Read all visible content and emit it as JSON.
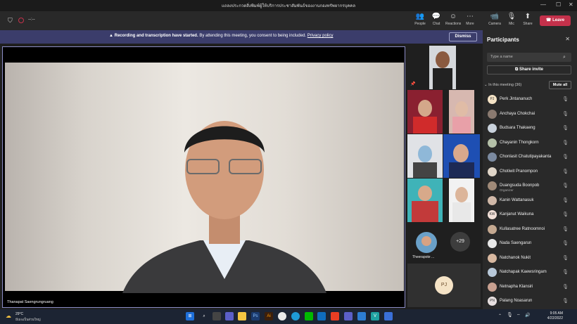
{
  "window": {
    "title": "แถลงประกวดสิ่งพิมพ์ผู้ให้บริการประชาสัมพันธ์ของงานกองทรัพยากรบุคคล",
    "minimize": "—",
    "maximize": "☐",
    "close": "✕"
  },
  "toolbar": {
    "timer": "--:--",
    "buttons": [
      {
        "label": "People",
        "icon": "people-icon",
        "glyph": "👥"
      },
      {
        "label": "Chat",
        "icon": "chat-icon",
        "glyph": "💬"
      },
      {
        "label": "Reactions",
        "icon": "reactions-icon",
        "glyph": "☺"
      },
      {
        "label": "More",
        "icon": "more-icon",
        "glyph": "⋯"
      },
      {
        "label": "Camera",
        "icon": "camera-icon",
        "glyph": "📹"
      },
      {
        "label": "Mic",
        "icon": "mic-icon",
        "glyph": "🎙"
      },
      {
        "label": "Share",
        "icon": "share-icon",
        "glyph": "⬆"
      }
    ],
    "leave_label": "Leave"
  },
  "banner": {
    "bold": "Recording and transcription have started.",
    "text": "By attending this meeting, you consent to being included.",
    "link": "Privacy policy",
    "dismiss": "Dismiss"
  },
  "stage": {
    "main_speaker": "Thanapat Saengrungruang",
    "overflow_count": "+29",
    "tile_name": "Theerapote ...",
    "you_initials": "PJ"
  },
  "participants": {
    "header": "Participants",
    "search_placeholder": "Type a name",
    "share_invite": "Share invite",
    "in_meeting": "In this meeting (36)",
    "mute_all": "Mute all",
    "people": [
      {
        "name": "Perk Jintananuch",
        "initials": "PJ",
        "sub": ""
      },
      {
        "name": "Anchaya Chokchai",
        "initials": "",
        "sub": ""
      },
      {
        "name": "Budsara Thakaeng",
        "initials": "",
        "sub": ""
      },
      {
        "name": "Chayanin Thongkorn",
        "initials": "",
        "sub": ""
      },
      {
        "name": "Chonlasit Chatutipayakanta",
        "initials": "",
        "sub": ""
      },
      {
        "name": "Chotiwit Pranompon",
        "initials": "",
        "sub": ""
      },
      {
        "name": "Duangsuda Boonpob",
        "initials": "",
        "sub": "Organizer"
      },
      {
        "name": "Kanin Wattanasuk",
        "initials": "",
        "sub": ""
      },
      {
        "name": "Kanjanut Waikuna",
        "initials": "KW",
        "sub": ""
      },
      {
        "name": "Kullasatree Ratnoomnoi",
        "initials": "",
        "sub": ""
      },
      {
        "name": "Nada Saengarun",
        "initials": "",
        "sub": ""
      },
      {
        "name": "Natchanok Nukit",
        "initials": "",
        "sub": ""
      },
      {
        "name": "Natchapak Kaewsringam",
        "initials": "",
        "sub": ""
      },
      {
        "name": "Netnapha Klansiri",
        "initials": "",
        "sub": ""
      },
      {
        "name": "Palang Noasarun",
        "initials": "PN",
        "sub": ""
      }
    ]
  },
  "taskbar": {
    "weather_temp": "29°C",
    "weather_desc": "มีเมฆเป็นส่วนใหญ่",
    "time": "9:05 AM",
    "date": "4/22/2022"
  }
}
